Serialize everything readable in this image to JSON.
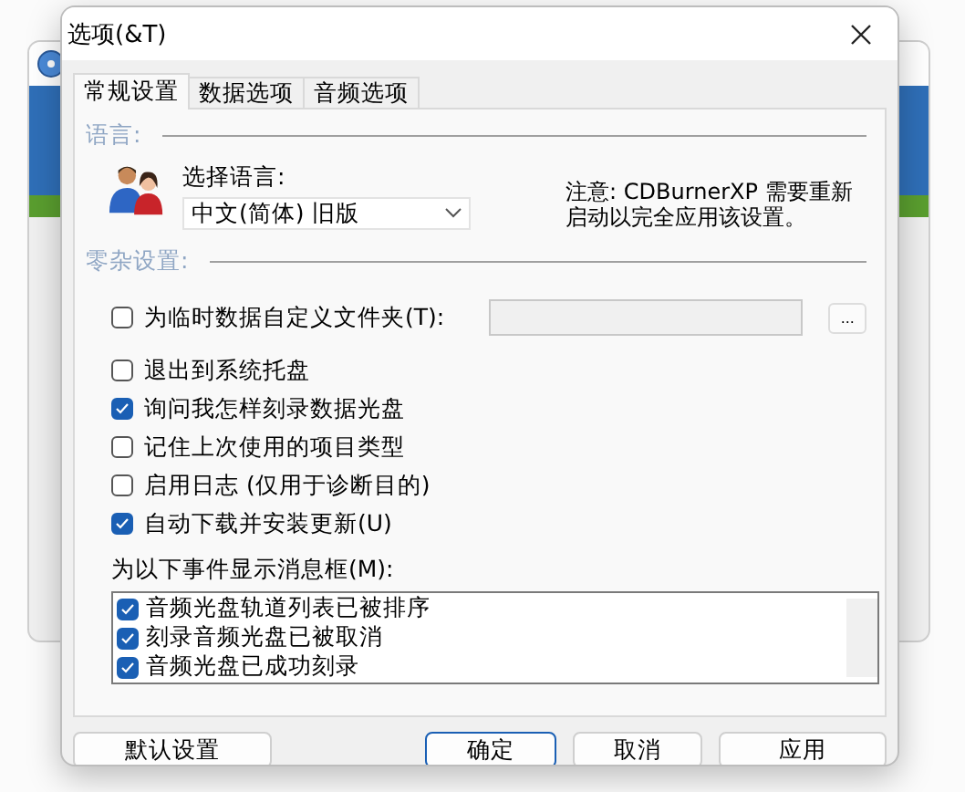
{
  "window": {
    "title": "选项(&T)"
  },
  "tabs": [
    {
      "label": "常规设置",
      "selected": true
    },
    {
      "label": "数据选项",
      "selected": false
    },
    {
      "label": "音频选项",
      "selected": false
    }
  ],
  "language": {
    "heading": "语言:",
    "label": "选择语言:",
    "value": "中文(简体) 旧版",
    "note": "注意: CDBurnerXP 需要重新启动以完全应用该设置。"
  },
  "misc": {
    "heading": "零杂设置:",
    "temp_folder": {
      "label": "为临时数据自定义文件夹(T):",
      "checked": false,
      "browse": "..."
    },
    "options": [
      {
        "label": "退出到系统托盘",
        "checked": false
      },
      {
        "label": "询问我怎样刻录数据光盘",
        "checked": true
      },
      {
        "label": "记住上次使用的项目类型",
        "checked": false
      },
      {
        "label": "启用日志 (仅用于诊断目的)",
        "checked": false
      },
      {
        "label": "自动下载并安装更新(U)",
        "checked": true
      }
    ],
    "events_label": "为以下事件显示消息框(M):",
    "events": [
      {
        "label": "音频光盘轨道列表已被排序",
        "checked": true
      },
      {
        "label": "刻录音频光盘已被取消",
        "checked": true
      },
      {
        "label": "音频光盘已成功刻录",
        "checked": true
      }
    ]
  },
  "buttons": [
    {
      "label": "默认设置",
      "default": false
    },
    {
      "label": "确定",
      "default": true
    },
    {
      "label": "取消",
      "default": false
    },
    {
      "label": "应用",
      "default": false
    }
  ]
}
